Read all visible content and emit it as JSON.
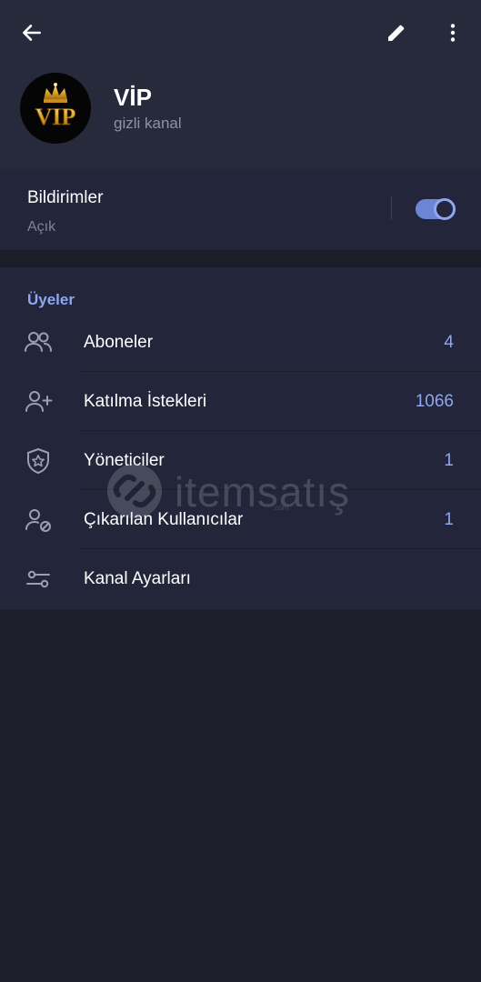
{
  "header": {
    "back_icon": "arrow-left-icon",
    "edit_icon": "pencil-icon",
    "more_icon": "more-vertical-icon",
    "avatar_text": "VIP",
    "channel_name": "VİP",
    "channel_type": "gizli kanal"
  },
  "notifications": {
    "title": "Bildirimler",
    "status": "Açık",
    "enabled": true
  },
  "members": {
    "section_title": "Üyeler",
    "items": [
      {
        "label": "Aboneler",
        "count": "4",
        "icon": "users-icon"
      },
      {
        "label": "Katılma İstekleri",
        "count": "1066",
        "icon": "user-plus-icon"
      },
      {
        "label": "Yöneticiler",
        "count": "1",
        "icon": "shield-star-icon"
      },
      {
        "label": "Çıkarılan Kullanıcılar",
        "count": "1",
        "icon": "user-blocked-icon"
      },
      {
        "label": "Kanal Ayarları",
        "count": "",
        "icon": "sliders-icon"
      }
    ]
  },
  "watermark": {
    "text": "itemsatış",
    "subtext": ".com"
  },
  "colors": {
    "accent": "#8ea7f0",
    "background": "#1d1f2b",
    "header_bg": "#262a3a",
    "card_bg": "#23263a"
  }
}
